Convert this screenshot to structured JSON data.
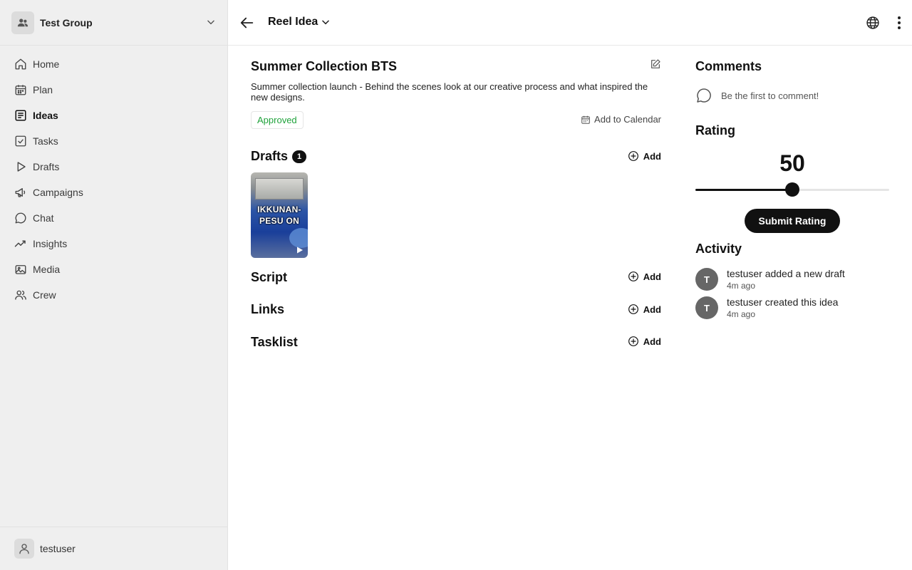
{
  "sidebar": {
    "group_name": "Test Group",
    "nav": [
      {
        "label": "Home",
        "icon": "home-icon"
      },
      {
        "label": "Plan",
        "icon": "calendar-icon"
      },
      {
        "label": "Ideas",
        "icon": "ideas-icon",
        "active": true
      },
      {
        "label": "Tasks",
        "icon": "checkbox-icon"
      },
      {
        "label": "Drafts",
        "icon": "play-icon"
      },
      {
        "label": "Campaigns",
        "icon": "megaphone-icon"
      },
      {
        "label": "Chat",
        "icon": "chat-bubble-icon"
      },
      {
        "label": "Insights",
        "icon": "trend-icon"
      },
      {
        "label": "Media",
        "icon": "image-icon"
      },
      {
        "label": "Crew",
        "icon": "users-icon"
      }
    ],
    "user_name": "testuser"
  },
  "header": {
    "idea_type": "Reel Idea"
  },
  "idea": {
    "title": "Summer Collection BTS",
    "description": "Summer collection launch - Behind the scenes look at our creative process and what inspired the new designs.",
    "status": "Approved",
    "add_to_calendar": "Add to Calendar"
  },
  "sections": {
    "drafts": {
      "title": "Drafts",
      "count": "1",
      "add_label": "Add",
      "thumbnail_caption": "IKKUNAN-PESU ON"
    },
    "script": {
      "title": "Script",
      "add_label": "Add"
    },
    "links": {
      "title": "Links",
      "add_label": "Add"
    },
    "tasklist": {
      "title": "Tasklist",
      "add_label": "Add"
    }
  },
  "comments": {
    "title": "Comments",
    "empty_text": "Be the first to comment!"
  },
  "rating": {
    "title": "Rating",
    "value": "50",
    "fraction": 0.5,
    "submit_label": "Submit Rating"
  },
  "activity": {
    "title": "Activity",
    "items": [
      {
        "initial": "T",
        "text": "testuser added a new draft",
        "time": "4m ago"
      },
      {
        "initial": "T",
        "text": "testuser created this idea",
        "time": "4m ago"
      }
    ]
  },
  "colors": {
    "status_green": "#1fa23b",
    "sidebar_bg": "#efefef",
    "primary": "#111111"
  }
}
